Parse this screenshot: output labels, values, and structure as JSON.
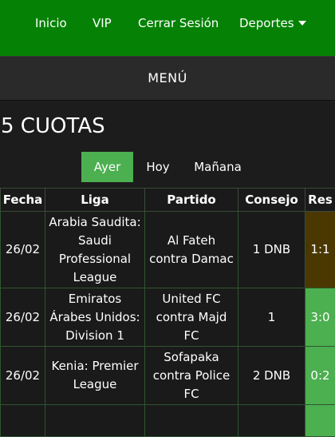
{
  "nav": {
    "items": [
      "Inicio",
      "VIP",
      "Cerrar Sesión",
      "Deportes"
    ]
  },
  "menu": {
    "label": "MENÚ"
  },
  "page": {
    "title": "5 CUOTAS"
  },
  "day_tabs": {
    "items": [
      "Ayer",
      "Hoy",
      "Mañana"
    ],
    "active": "Ayer"
  },
  "table": {
    "headers": [
      "Fecha",
      "Liga",
      "Partido",
      "Consejo",
      "Res"
    ],
    "rows": [
      {
        "fecha": "26/02",
        "liga": "Arabia Saudita: Saudi Professional League",
        "partido": "Al Fateh contra Damac",
        "consejo": "1 DNB",
        "res": "1:1",
        "status": "pending"
      },
      {
        "fecha": "26/02",
        "liga": "Emiratos Árabes Unidos: Division 1",
        "partido": "United FC contra Majd FC",
        "consejo": "1",
        "res": "3:0",
        "status": "won"
      },
      {
        "fecha": "26/02",
        "liga": "Kenia: Premier League",
        "partido": "Sofapaka contra Police FC",
        "consejo": "2 DNB",
        "res": "0:2",
        "status": "won"
      }
    ]
  },
  "colors": {
    "nav_bg": "#058205",
    "active_tab": "#4caf50",
    "result_won": "#4caf50",
    "result_pending": "#4a3800"
  },
  "icons": {
    "dropdown": "caret-down-icon"
  }
}
